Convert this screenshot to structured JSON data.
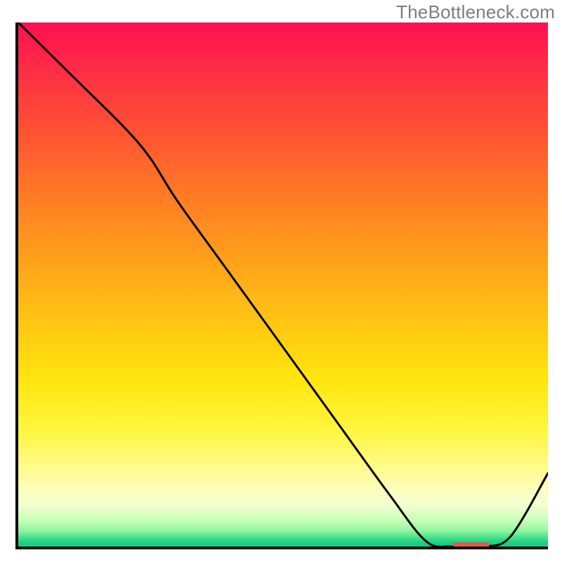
{
  "watermark": "TheBottleneck.com",
  "colors": {
    "gradient_top": "#ff1051",
    "gradient_bottom": "#19ce83",
    "curve": "#000000",
    "axis": "#000000",
    "marker": "#e35a4e"
  },
  "chart_data": {
    "type": "line",
    "title": "",
    "xlabel": "",
    "ylabel": "",
    "xlim": [
      0,
      100
    ],
    "ylim": [
      0,
      100
    ],
    "x": [
      0,
      10,
      20,
      25,
      30,
      40,
      50,
      60,
      70,
      77,
      82,
      88,
      93,
      100
    ],
    "values": [
      100,
      90,
      80,
      74,
      66,
      52,
      38,
      24,
      10,
      1,
      0,
      0,
      2,
      14
    ],
    "marker": {
      "x_range": [
        82,
        89
      ],
      "y": 0.4
    },
    "annotations": []
  }
}
